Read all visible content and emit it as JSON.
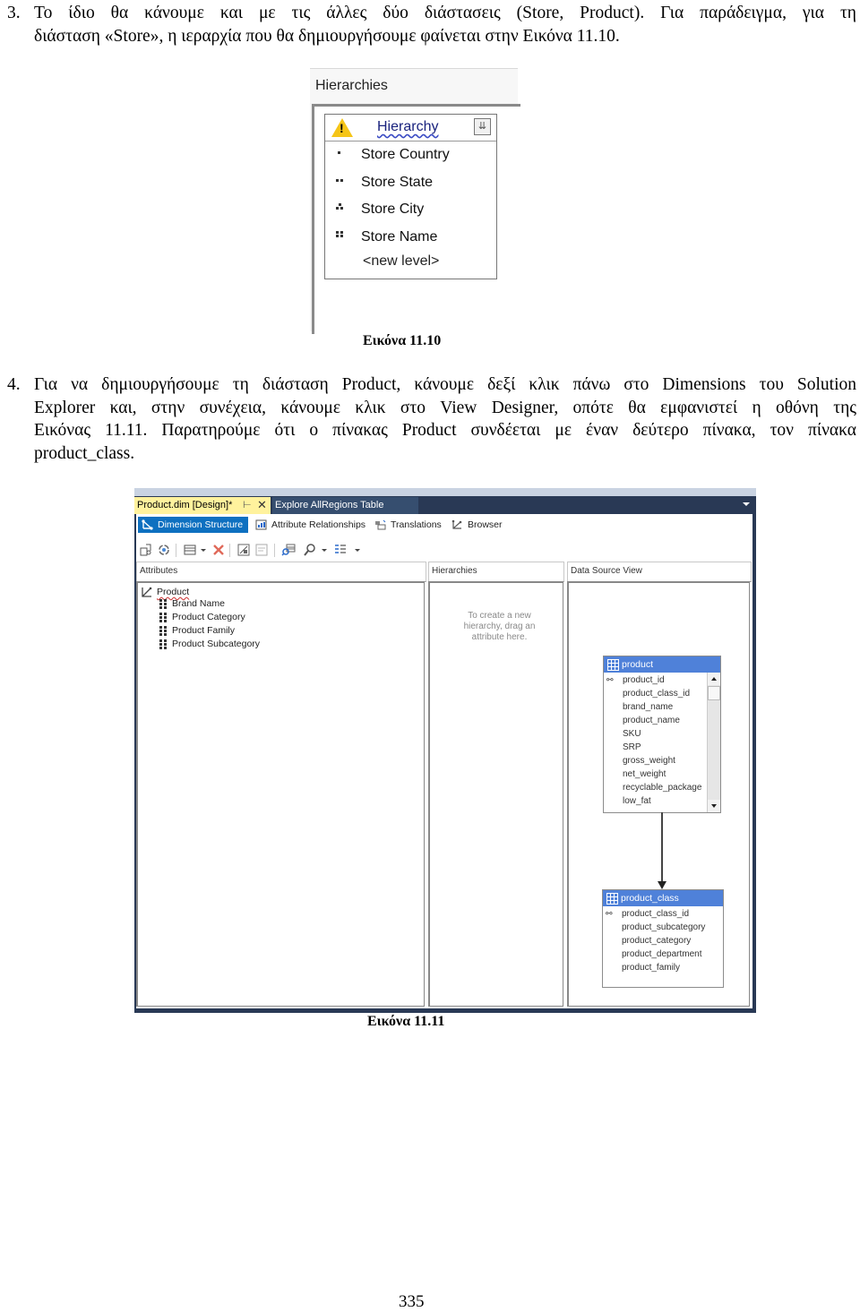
{
  "paragraphs": [
    {
      "number": "3.",
      "line1": "Το ίδιο θα κάνουμε και με τις άλλες δύο διάστασεις (Store, Product). Για παράδειγμα, για τη",
      "line2": "διάσταση «Store», η ιεραρχία που θα δημιουργήσουμε φαίνεται στην Εικόνα 11.10."
    },
    {
      "number": "4.",
      "line1": "Για να δημιουργήσουμε τη διάσταση Product, κάνουμε δεξί κλικ πάνω στο Dimensions του Solution",
      "line2": "Explorer και, στην συνέχεια, κάνουμε κλικ στο View Designer, οπότε θα εμφανιστεί η οθόνη της",
      "line3": "Εικόνας 11.11. Παρατηρούμε ότι ο πίνακας Product συνδέεται με έναν δεύτερο πίνακα, τον πίνακα",
      "line4": "product_class."
    }
  ],
  "figure_11_10": {
    "caption": "Εικόνα 11.10",
    "panel_title": "Hierarchies",
    "hierarchy_name": "Hierarchy",
    "warning_icon": "warning-icon",
    "levels": [
      {
        "label": "Store Country",
        "icon": "level-1-icon"
      },
      {
        "label": "Store State",
        "icon": "level-2-icon"
      },
      {
        "label": "Store City",
        "icon": "level-3-icon"
      },
      {
        "label": "Store Name",
        "icon": "level-4-icon"
      }
    ],
    "new_level": "<new level>"
  },
  "figure_11_11": {
    "caption": "Εικόνα 11.11",
    "tabs": [
      {
        "label": "Product.dim [Design]*",
        "active": true
      },
      {
        "label": "Explore AllRegions Table",
        "active": false
      }
    ],
    "subtabs": [
      {
        "label": "Dimension Structure",
        "active": true
      },
      {
        "label": "Attribute Relationships",
        "active": false
      },
      {
        "label": "Translations",
        "active": false
      },
      {
        "label": "Browser",
        "active": false
      }
    ],
    "panels": {
      "attributes": "Attributes",
      "hierarchies": "Hierarchies",
      "dsv": "Data Source View"
    },
    "attribute_root": "Product",
    "attributes": [
      "Brand Name",
      "Product Category",
      "Product Family",
      "Product Subcategory"
    ],
    "hierarchies_hint": [
      "To create a new",
      "hierarchy, drag an",
      "attribute here."
    ],
    "tables": [
      {
        "name": "product",
        "columns": [
          "product_id",
          "product_class_id",
          "brand_name",
          "product_name",
          "SKU",
          "SRP",
          "gross_weight",
          "net_weight",
          "recyclable_package",
          "low_fat"
        ],
        "key_column": "product_id"
      },
      {
        "name": "product_class",
        "columns": [
          "product_class_id",
          "product_subcategory",
          "product_category",
          "product_department",
          "product_family"
        ],
        "key_column": "product_class_id"
      }
    ],
    "colors": {
      "active_tab": "#fff29d",
      "ide_frame": "#293955",
      "active_subtab": "#0e70c0",
      "table_header": "#4f81d9"
    }
  },
  "page_number": "335"
}
